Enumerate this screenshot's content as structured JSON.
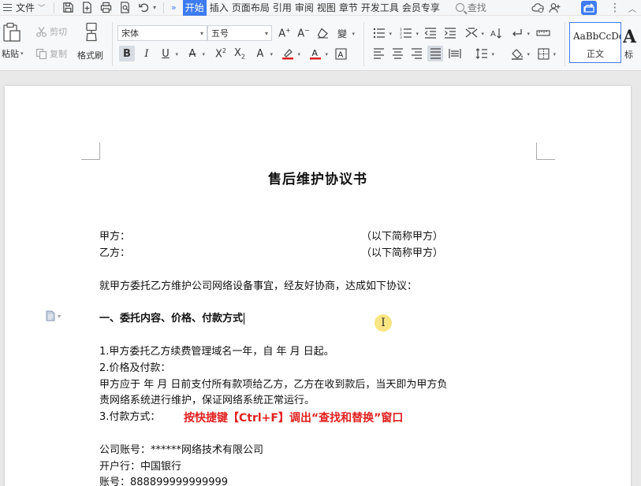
{
  "menubar": {
    "file_label": "文件",
    "tabs": [
      {
        "label": "开始",
        "active": true
      },
      {
        "label": "插入"
      },
      {
        "label": "页面布局"
      },
      {
        "label": "引用"
      },
      {
        "label": "审阅"
      },
      {
        "label": "视图"
      },
      {
        "label": "章节"
      },
      {
        "label": "开发工具"
      },
      {
        "label": "会员专享"
      }
    ],
    "more_arrows": "»",
    "search_label": "查找"
  },
  "ribbon": {
    "paste_label": "粘贴",
    "cut_label": "剪切",
    "copy_label": "复制",
    "format_painter_label": "格式刷",
    "font_name": "宋体",
    "font_size": "五号",
    "style_sample": "AaBbCcDd",
    "style_name": "正文",
    "style_next_sample": "A",
    "style_next_name": "标"
  },
  "document": {
    "title": "售后维护协议书",
    "party_a": "甲方：",
    "party_a_note": "（以下简称甲方）",
    "party_b": "乙方：",
    "party_b_note": "（以下简称甲方）",
    "intro": "就甲方委托乙方维护公司网络设备事宜，经友好协商，达成如下协议：",
    "section1": "一、委托内容、价格、付款方式",
    "item1": "1.甲方委托乙方续费管理域名一年，自      年      月      日起。",
    "item2": "2.价格及付款：",
    "item2_detail_1": "甲方应于          年      月      日前支付所有款项给乙方，乙方在收到款后，当天即为甲方负",
    "item2_detail_2": "责网络系统进行维护，保证网络系统正常运行。",
    "item3": "3.付款方式：",
    "account": "公司账号：******网络技术有限公司",
    "bank": "开户行：中国银行",
    "account_no": "账号：888899999999999"
  },
  "annotation": "按快捷键【Ctrl+F】调出“查找和替换”窗口",
  "colors": {
    "accent": "#3d7cf1",
    "annotation": "#e02020",
    "font_color_underline": "#e02020",
    "highlight_underline": "#e02020"
  }
}
